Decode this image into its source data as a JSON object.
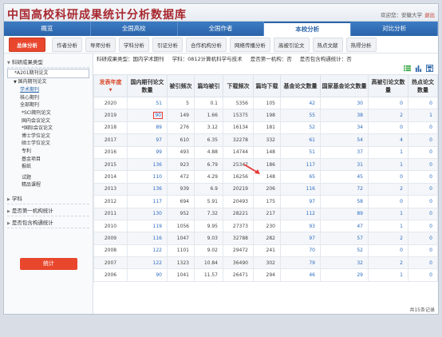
{
  "app": {
    "title": "中国高校科研成果统计分析数据库",
    "welcome": "欢迎您：安徽大学",
    "logout": "退出"
  },
  "mainnav": [
    "概览",
    "全国高校",
    "全国作者",
    "本校分析",
    "对比分析"
  ],
  "subnav": [
    "总体分析",
    "作者分析",
    "导师分析",
    "学科分析",
    "引证分析",
    "合作机构分析",
    "网络传播分析",
    "高被引论文",
    "热点文献",
    "热得分析"
  ],
  "criteria": {
    "type": "科研成果类型：国内学术期刊",
    "subject": "学科：0812计算机科学与技术",
    "first_org": "是否第一机构：否",
    "fund": "是否包含构通统计：否"
  },
  "sidebar": {
    "group1": "科研成果类型",
    "items": [
      {
        "label": "*A201期刊论文",
        "level": "l1"
      },
      {
        "label": "国内期刊论文",
        "level": "l1"
      },
      {
        "label": "学术期刊",
        "level": "l2"
      },
      {
        "label": "核心期刊",
        "level": "l2"
      },
      {
        "label": "全部期刊",
        "level": "l2"
      },
      {
        "label": "*SCI期刊论文",
        "level": "l1b"
      },
      {
        "label": "国内会议论文",
        "level": "l1b"
      },
      {
        "label": "*国际会议论文",
        "level": "l1b"
      },
      {
        "label": "博士学位论文",
        "level": "l1b"
      },
      {
        "label": "硕士学位论文",
        "level": "l1b"
      },
      {
        "label": "专利",
        "level": "l1b"
      },
      {
        "label": "基金项目",
        "level": "l1b"
      },
      {
        "label": "报纸",
        "level": "l1b"
      },
      {
        "label": "",
        "level": "sep"
      },
      {
        "label": "试题",
        "level": "l1b"
      },
      {
        "label": "精品课程",
        "level": "l1b"
      }
    ],
    "group2": "学科",
    "group3": "是否第一机构统计",
    "group4": "是否包含构通统计",
    "button": "统计"
  },
  "table": {
    "headers": [
      "发表年度",
      "国内期刊论文数量",
      "被引频次",
      "篇均被引",
      "下载频次",
      "篇均下载",
      "基金论文数量",
      "国家基金论文数量",
      "高被引论文数量",
      "热点论文数量"
    ],
    "rows": [
      [
        "2020",
        "51",
        "5",
        "0.1",
        "5356",
        "105",
        "42",
        "30",
        "0",
        "0"
      ],
      [
        "2019",
        "90",
        "149",
        "1.66",
        "15375",
        "198",
        "55",
        "38",
        "2",
        "1"
      ],
      [
        "2018",
        "89",
        "276",
        "3.12",
        "16134",
        "181",
        "52",
        "34",
        "0",
        "0"
      ],
      [
        "2017",
        "97",
        "610",
        "6.35",
        "32278",
        "332",
        "61",
        "54",
        "4",
        "0"
      ],
      [
        "2016",
        "99",
        "493",
        "4.88",
        "14744",
        "148",
        "51",
        "37",
        "1",
        "0"
      ],
      [
        "2015",
        "136",
        "923",
        "6.79",
        "25347",
        "186",
        "117",
        "31",
        "1",
        "0"
      ],
      [
        "2014",
        "110",
        "472",
        "4.29",
        "16256",
        "148",
        "65",
        "45",
        "0",
        "0"
      ],
      [
        "2013",
        "136",
        "939",
        "6.9",
        "20219",
        "206",
        "116",
        "72",
        "2",
        "0"
      ],
      [
        "2012",
        "117",
        "694",
        "5.91",
        "20493",
        "175",
        "97",
        "58",
        "0",
        "0"
      ],
      [
        "2011",
        "130",
        "952",
        "7.32",
        "28221",
        "217",
        "112",
        "89",
        "1",
        "0"
      ],
      [
        "2010",
        "119",
        "1056",
        "9.95",
        "27373",
        "230",
        "93",
        "47",
        "1",
        "0"
      ],
      [
        "2009",
        "116",
        "1047",
        "9.03",
        "32788",
        "282",
        "97",
        "57",
        "2",
        "0"
      ],
      [
        "2008",
        "122",
        "1101",
        "9.02",
        "29472",
        "241",
        "70",
        "52",
        "0",
        "0"
      ],
      [
        "2007",
        "122",
        "1323",
        "10.84",
        "36490",
        "302",
        "79",
        "32",
        "2",
        "0"
      ],
      [
        "2006",
        "90",
        "1041",
        "11.57",
        "26471",
        "294",
        "46",
        "29",
        "1",
        "0"
      ]
    ],
    "footer": "共15条记录"
  },
  "colors": {
    "brand_red": "#a8282e",
    "nav_blue": "#2a63a8",
    "accent_orange": "#e8472e",
    "link_blue": "#2d6cc2"
  }
}
